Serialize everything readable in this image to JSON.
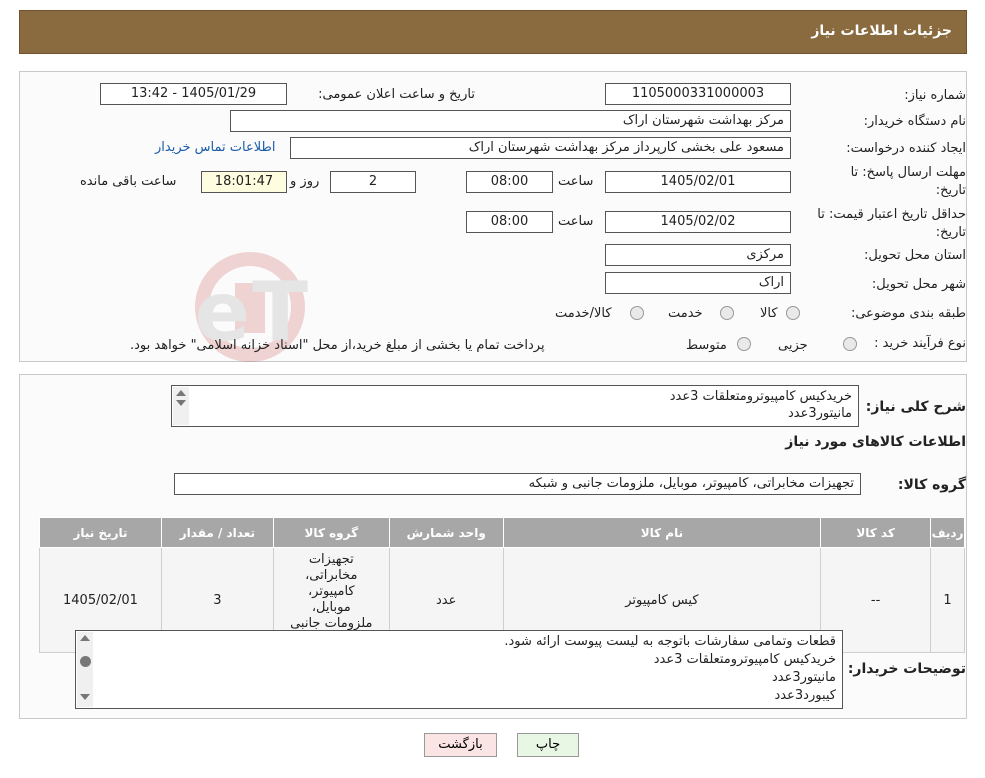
{
  "header": {
    "title": "جزئیات اطلاعات نیاز"
  },
  "form": {
    "need_number_label": "شماره نیاز:",
    "need_number": "1105000331000003",
    "announce_label": "تاریخ و ساعت اعلان عمومی:",
    "announce_value": "1405/01/29 - 13:42",
    "buyer_org_label": "نام دستگاه خریدار:",
    "buyer_org": "مرکز بهداشت شهرستان اراک",
    "requester_label": "ایجاد کننده درخواست:",
    "requester": "مسعود علی بخشی کارپرداز مرکز بهداشت شهرستان اراک",
    "contact_link": "اطلاعات تماس خریدار",
    "deadline_label_1": "مهلت ارسال پاسخ: تا",
    "deadline_label_2": "تاریخ:",
    "deadline_date": "1405/02/01",
    "time_label": "ساعت",
    "deadline_time": "08:00",
    "days_value": "2",
    "days_label": "روز و",
    "remaining_time": "18:01:47",
    "remaining_label": "ساعت باقی مانده",
    "validity_label_1": "حداقل تاریخ اعتبار قیمت: تا",
    "validity_label_2": "تاریخ:",
    "validity_date": "1405/02/02",
    "validity_time": "08:00",
    "province_label": "استان محل تحویل:",
    "province": "مرکزی",
    "city_label": "شهر محل تحویل:",
    "city": "اراک",
    "category_label": "طبقه بندی موضوعی:",
    "category_options": [
      "کالا",
      "خدمت",
      "کالا/خدمت"
    ],
    "process_label": "نوع فرآیند خرید :",
    "process_options": [
      "جزیی",
      "متوسط"
    ],
    "process_note": "پرداخت تمام یا بخشی از مبلغ خرید،از محل \"اسناد خزانه اسلامی\" خواهد بود."
  },
  "summary": {
    "label": "شرح کلی نیاز:",
    "lines": [
      "خریدکیس کامپیوترومتعلقات 3عدد",
      "مانیتور3عدد"
    ]
  },
  "goods": {
    "section_title": "اطلاعات کالاهای مورد نیاز",
    "group_label": "گروه کالا:",
    "group_value": "تجهیزات مخابراتی، کامپیوتر، موبایل، ملزومات جانبی و شبکه",
    "columns": [
      "ردیف",
      "کد کالا",
      "نام کالا",
      "واحد شمارش",
      "گروه کالا",
      "تعداد / مقدار",
      "تاریخ نیاز"
    ],
    "rows": [
      {
        "row": "1",
        "code": "--",
        "name": "کیس کامپیوتر",
        "unit": "عدد",
        "group": "تجهیزات مخابراتی، کامپیوتر، موبایل، ملزومات جانبی و شبکه",
        "qty": "3",
        "date": "1405/02/01"
      }
    ]
  },
  "buyer_notes": {
    "label": "توضیحات خریدار:",
    "lines": [
      "قطعات وتمامی سفارشات باتوجه به  لیست پیوست ارائه شود.",
      "خریدکیس کامپیوترومتعلقات 3عدد",
      "مانیتور3عدد",
      "کیبورد3عدد"
    ]
  },
  "buttons": {
    "print": "چاپ",
    "back": "بازگشت"
  },
  "watermark": {
    "text": "AriaTender.neT"
  },
  "colors": {
    "header_bg": "#8a6a3f",
    "link": "#1a5ca8",
    "print_btn": "#e8f6e4",
    "back_btn": "#fbe4e4"
  }
}
